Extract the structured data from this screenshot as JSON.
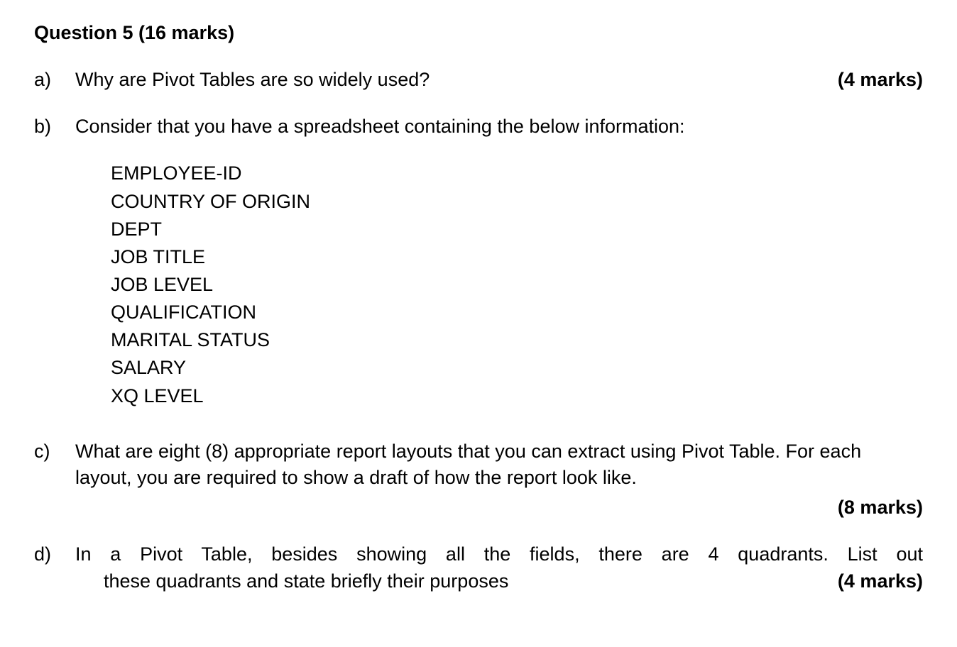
{
  "heading": "Question 5 (16 marks)",
  "partA": {
    "label": "a)",
    "text": "Why are Pivot Tables are so widely used?",
    "marks": "(4 marks)"
  },
  "partB": {
    "label": "b)",
    "text": "Consider that you have a spreadsheet containing the below information:",
    "fields": [
      "EMPLOYEE-ID",
      "COUNTRY OF ORIGIN",
      "DEPT",
      "JOB TITLE",
      "JOB LEVEL",
      "QUALIFICATION",
      "MARITAL STATUS",
      "SALARY",
      "XQ LEVEL"
    ]
  },
  "partC": {
    "label": "c)",
    "text": "What are eight (8) appropriate report layouts that you can extract using Pivot Table. For each layout, you are required to show a draft of how the report look like.",
    "marks": "(8 marks)"
  },
  "partD": {
    "label": "d)",
    "line1": "In a Pivot Table, besides showing all the fields, there are 4 quadrants. List out",
    "line2": "these quadrants and state briefly their purposes",
    "marks": "(4 marks)"
  }
}
